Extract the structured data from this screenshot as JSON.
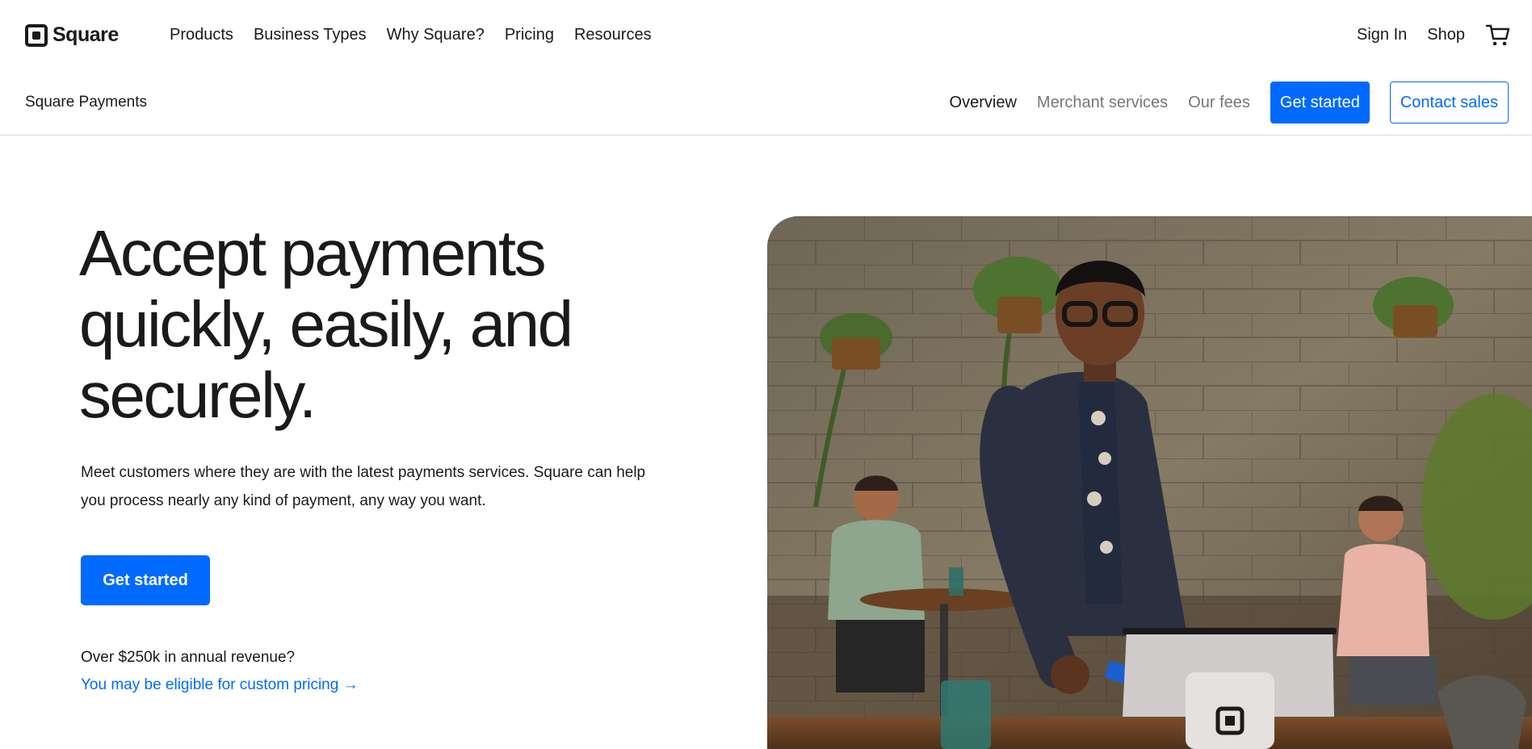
{
  "brand": {
    "name": "Square",
    "icon": "square-logo-icon"
  },
  "main_nav": [
    "Products",
    "Business Types",
    "Why Square?",
    "Pricing",
    "Resources"
  ],
  "right_nav": {
    "sign_in": "Sign In",
    "shop": "Shop",
    "cart_icon": "cart-icon"
  },
  "subnav": {
    "title": "Square Payments",
    "links": [
      {
        "label": "Overview",
        "active": true
      },
      {
        "label": "Merchant services",
        "active": false
      },
      {
        "label": "Our fees",
        "active": false
      }
    ],
    "get_started": "Get started",
    "contact_sales": "Contact sales"
  },
  "hero": {
    "title_lines": [
      "Accept payments",
      "quickly, easily, and",
      "securely."
    ],
    "description_lines": [
      "Meet customers where they are with the latest payments services. Square can help",
      "you process nearly any kind of payment, any way you want."
    ],
    "cta": "Get started",
    "revenue_question": "Over $250k in annual revenue?",
    "pricing_link": "You may be eligible for custom pricing →"
  },
  "colors": {
    "accent": "#006aff",
    "text": "#1a1a1a",
    "muted": "#767676"
  }
}
